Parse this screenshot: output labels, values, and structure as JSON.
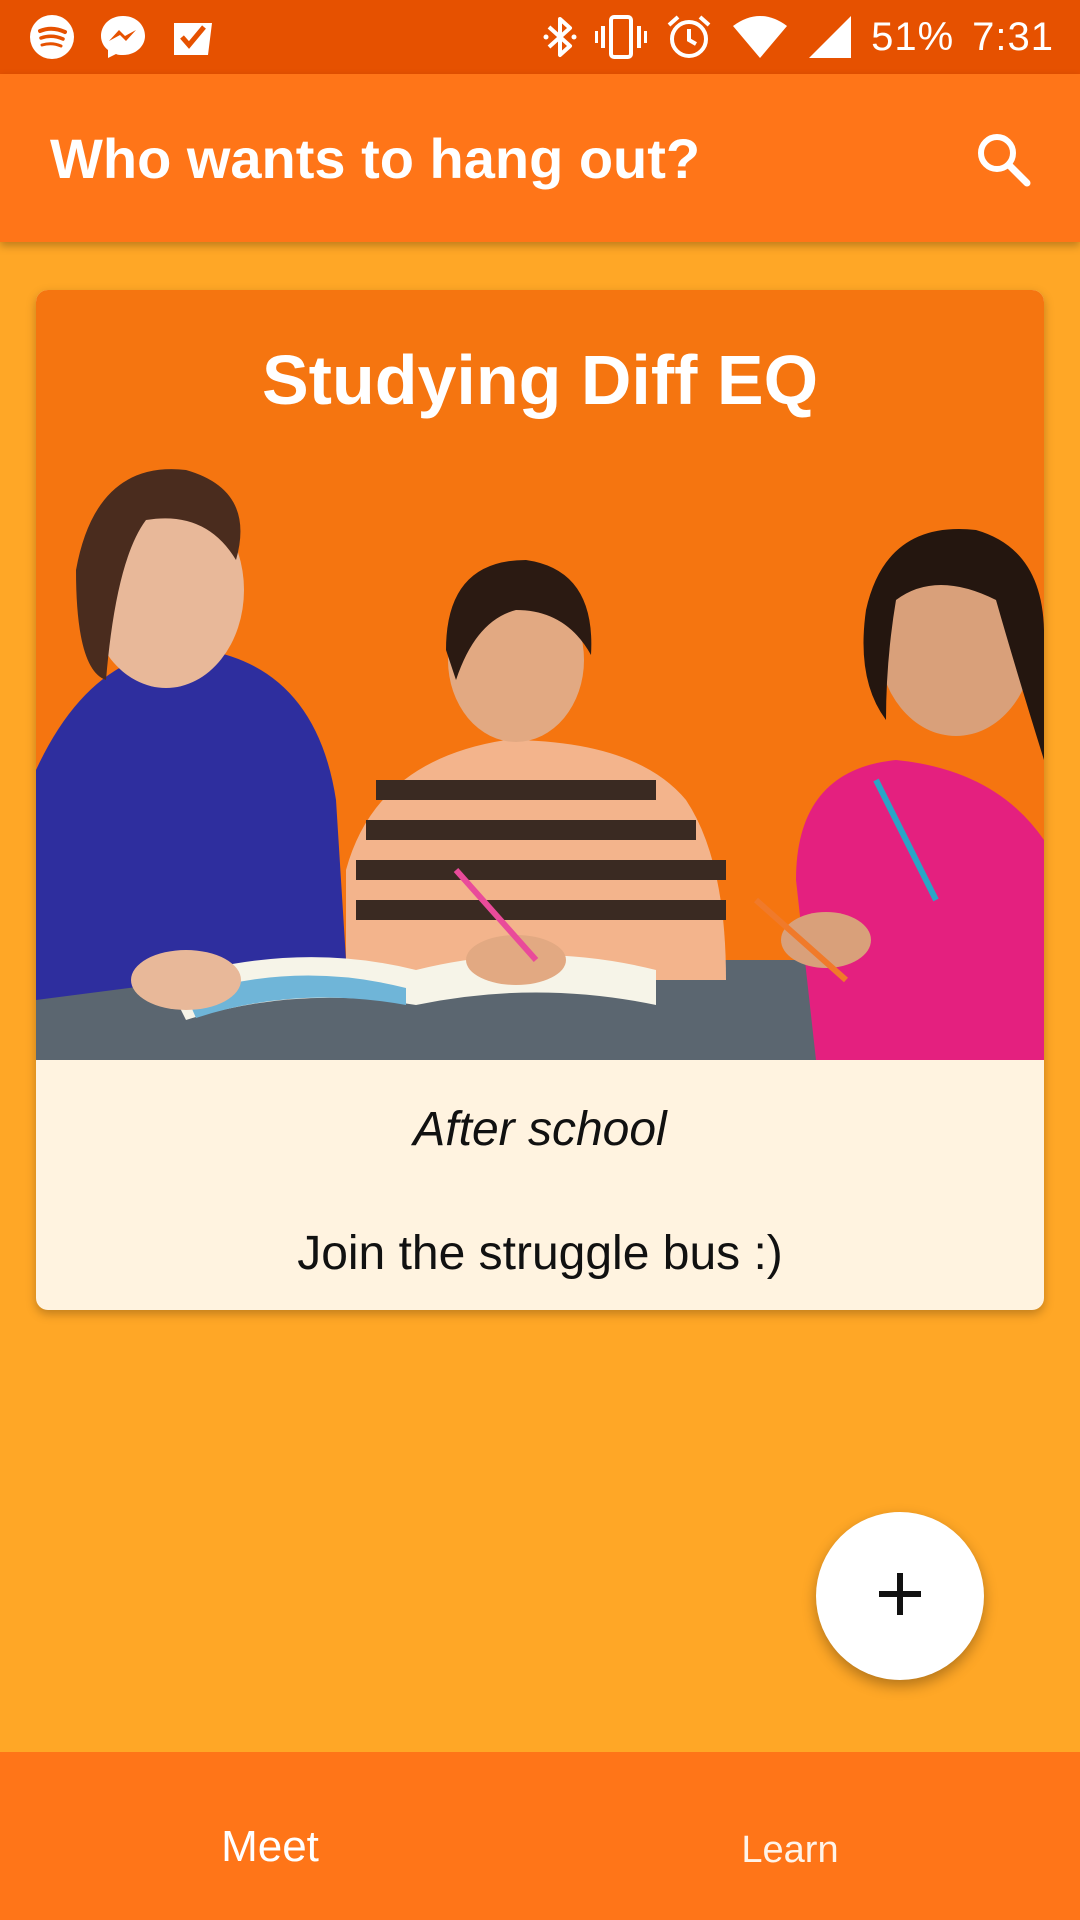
{
  "status_bar": {
    "left_icons": [
      "spotify-icon",
      "messenger-icon",
      "inbox-check-icon"
    ],
    "right_icons": [
      "bluetooth-icon",
      "vibrate-icon",
      "alarm-icon",
      "wifi-icon",
      "signal-icon"
    ],
    "battery": "51%",
    "time": "7:31"
  },
  "app_bar": {
    "title": "Who wants to hang out?",
    "action_icon": "search-icon"
  },
  "card": {
    "title": "Studying Diff EQ",
    "image": "students-studying-photo",
    "subtitle": "After school",
    "description": "Join the struggle bus :)"
  },
  "fab": {
    "icon": "plus-icon"
  },
  "bottom_nav": {
    "items": [
      {
        "label": "Meet"
      },
      {
        "label": "Learn"
      }
    ]
  },
  "colors": {
    "status_bar": "#E65100",
    "app_bar": "#FF7518",
    "background": "#FFA726",
    "card_body": "#FFF3E0",
    "card_hero": "#F57510"
  }
}
